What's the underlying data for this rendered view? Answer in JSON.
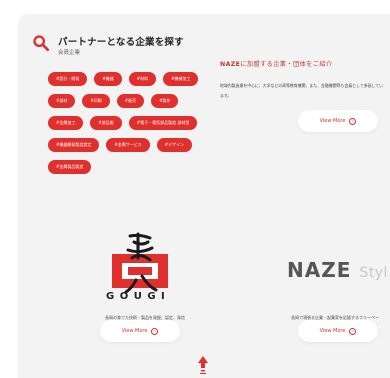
{
  "partner_section": {
    "title": "パートナーとなる企業を探す",
    "subtitle": "会員企業",
    "accent_color": "#e0302e"
  },
  "tags": [
    [
      "#設計・開発",
      "#機器",
      "#材料",
      "#機械加工"
    ],
    [
      "#部材",
      "#印刷",
      "#販売",
      "#製作"
    ],
    [
      "#金属加工",
      "#部品販",
      "#電子・電気部品製造 部材型"
    ],
    [
      "#機器開発製造設定",
      "#金属サービス",
      "#デザイン"
    ],
    [
      "#金属製品製造"
    ]
  ],
  "naze_intro": {
    "heading_brand": "NAZE",
    "heading_rest": "に加盟する企業・団体をご紹介",
    "description": "地域内製造業を中心に、大学などの高等教育機関、また、金融機関等も会員として参画しています。",
    "view_more": "View More"
  },
  "gougi": {
    "logo_text": "GOUGI",
    "description": "長岡の育てた技術・製品を発掘、認定、発信",
    "view_more": "View More"
  },
  "naze_style": {
    "logo_main": "NAZE",
    "logo_sub": "Styl",
    "description": "長岡で頑張る企業・起業家を応援するフリーペーパー",
    "view_more": "View More"
  },
  "icons": {
    "search": "search-icon",
    "arrow": "arrow-right-icon",
    "to_top": "page-top-icon"
  }
}
